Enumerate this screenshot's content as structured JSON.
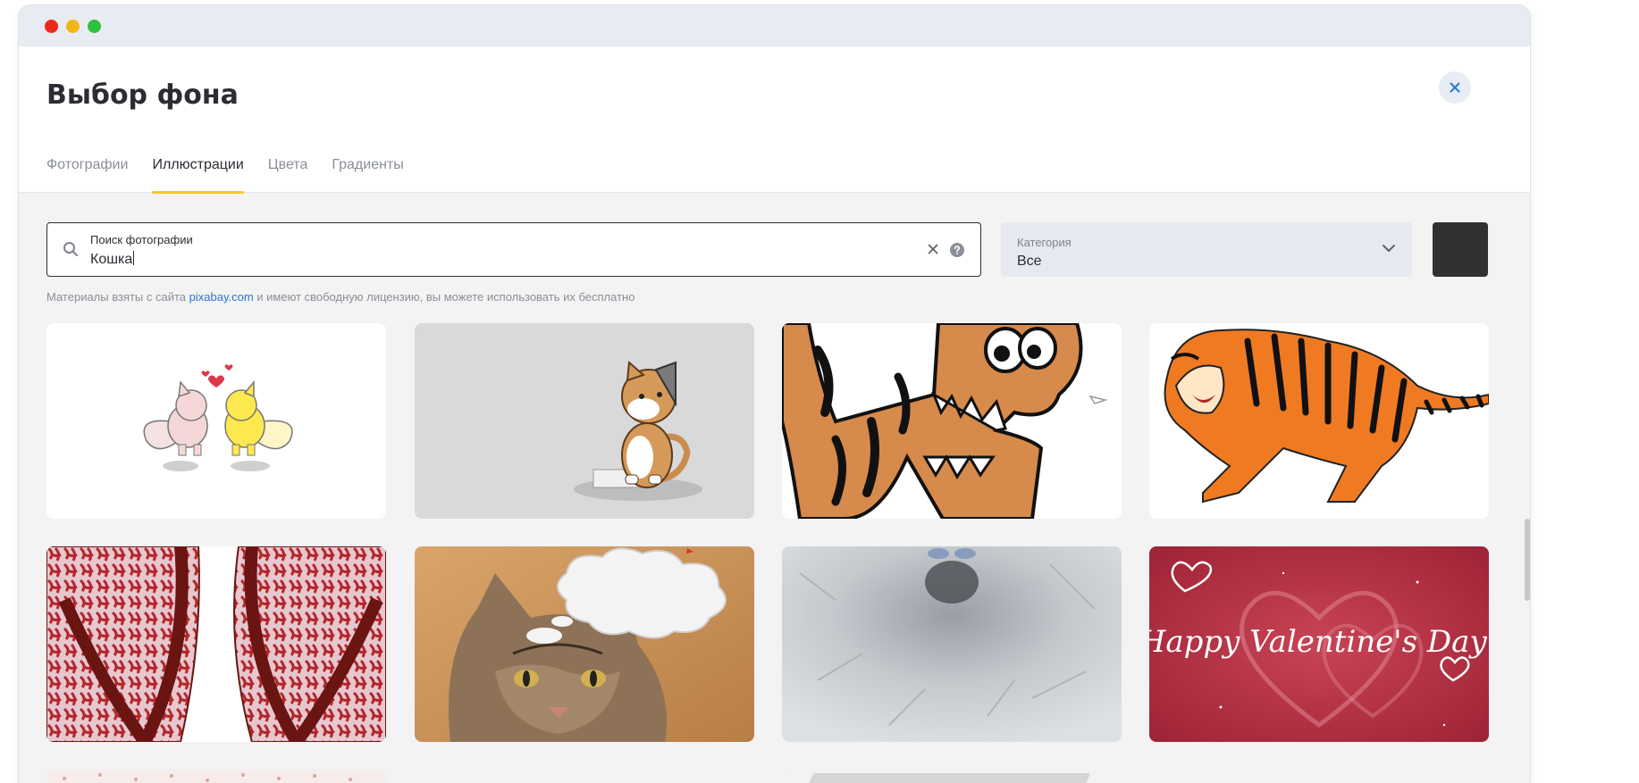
{
  "header": {
    "title": "Выбор фона",
    "tabs": [
      {
        "label": "Фотографии",
        "active": false
      },
      {
        "label": "Иллюстрации",
        "active": true
      },
      {
        "label": "Цвета",
        "active": false
      },
      {
        "label": "Градиенты",
        "active": false
      }
    ]
  },
  "search": {
    "label": "Поиск фотографии",
    "value": "Кошка"
  },
  "category": {
    "label": "Категория",
    "value": "Все"
  },
  "color_swatch": "#303133",
  "notice": {
    "before": "Материалы взяты с сайта ",
    "link": "pixabay.com",
    "after": " и имеют свободную лицензию, вы можете использовать их бесплатно"
  },
  "valentine_text": "Happy Valentine's Day!",
  "colors": {
    "accent_tab": "#f3c829",
    "link": "#2a75d8",
    "close_icon": "#2a75d8"
  }
}
